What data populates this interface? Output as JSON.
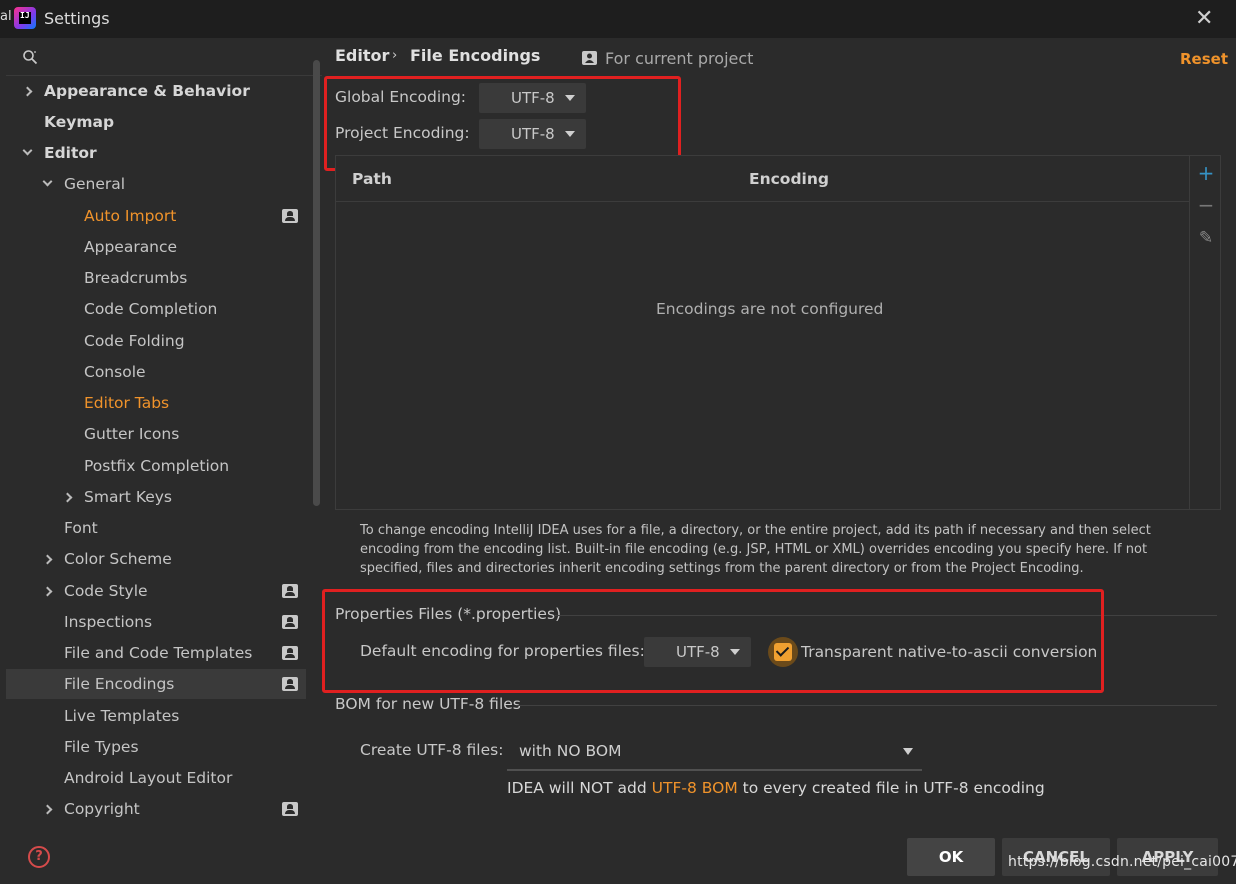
{
  "window": {
    "edge_text": "al",
    "app_icon_text": "IJ",
    "title": "Settings",
    "close_glyph": "✕"
  },
  "sidebar": {
    "items": [
      {
        "label": "Appearance & Behavior",
        "bold": true,
        "chevron": "right"
      },
      {
        "label": "Keymap",
        "bold": true
      },
      {
        "label": "Editor",
        "bold": true,
        "chevron": "down"
      },
      {
        "label": "General",
        "chevron": "down"
      },
      {
        "label": "Auto Import",
        "highlight": "orange",
        "project_badge": true
      },
      {
        "label": "Appearance"
      },
      {
        "label": "Breadcrumbs"
      },
      {
        "label": "Code Completion"
      },
      {
        "label": "Code Folding"
      },
      {
        "label": "Console"
      },
      {
        "label": "Editor Tabs",
        "highlight": "orange"
      },
      {
        "label": "Gutter Icons"
      },
      {
        "label": "Postfix Completion"
      },
      {
        "label": "Smart Keys",
        "chevron": "right"
      },
      {
        "label": "Font"
      },
      {
        "label": "Color Scheme",
        "chevron": "right"
      },
      {
        "label": "Code Style",
        "chevron": "right",
        "project_badge": true
      },
      {
        "label": "Inspections",
        "project_badge": true
      },
      {
        "label": "File and Code Templates",
        "project_badge": true
      },
      {
        "label": "File Encodings",
        "selected": true,
        "project_badge": true
      },
      {
        "label": "Live Templates"
      },
      {
        "label": "File Types"
      },
      {
        "label": "Android Layout Editor"
      },
      {
        "label": "Copyright",
        "chevron": "right",
        "project_badge": true
      }
    ],
    "help_glyph": "?"
  },
  "header": {
    "breadcrumb": [
      "Editor",
      "File Encodings"
    ],
    "breadcrumb_sep": "›",
    "scope_label": "For current project",
    "reset_label": "Reset"
  },
  "encodings": {
    "global_label": "Global Encoding:",
    "global_value": "UTF-8",
    "project_label": "Project Encoding:",
    "project_value": "UTF-8"
  },
  "table": {
    "columns": [
      "Path",
      "Encoding"
    ],
    "empty_text": "Encodings are not configured",
    "tools": {
      "add": "+",
      "remove": "−",
      "edit": "✎"
    }
  },
  "help_text": "To change encoding IntelliJ IDEA uses for a file, a directory, or the entire project, add its path if necessary and then select encoding from the encoding list. Built-in file encoding (e.g. JSP, HTML or XML) overrides encoding you specify here. If not specified, files and directories inherit encoding settings from the parent directory or from the Project Encoding.",
  "properties": {
    "section_title": "Properties Files (*.properties)",
    "default_label": "Default encoding for properties files:",
    "default_value": "UTF-8",
    "native_ascii_label": "Transparent native-to-ascii conversion",
    "native_ascii_checked": true
  },
  "bom": {
    "section_title": "BOM for new UTF-8 files",
    "create_label": "Create UTF-8 files:",
    "create_value": "with NO BOM",
    "note_prefix": "IDEA will NOT add",
    "note_link": "UTF-8 BOM",
    "note_suffix": "to every created file in UTF-8 encoding"
  },
  "buttons": {
    "ok": "OK",
    "cancel": "CANCEL",
    "apply": "APPLY"
  },
  "watermark": "https://blog.csdn.net/pei_cai007",
  "colors": {
    "accent_orange": "#f0932b",
    "annotation_red": "#e02020",
    "background": "#2b2b2b"
  }
}
